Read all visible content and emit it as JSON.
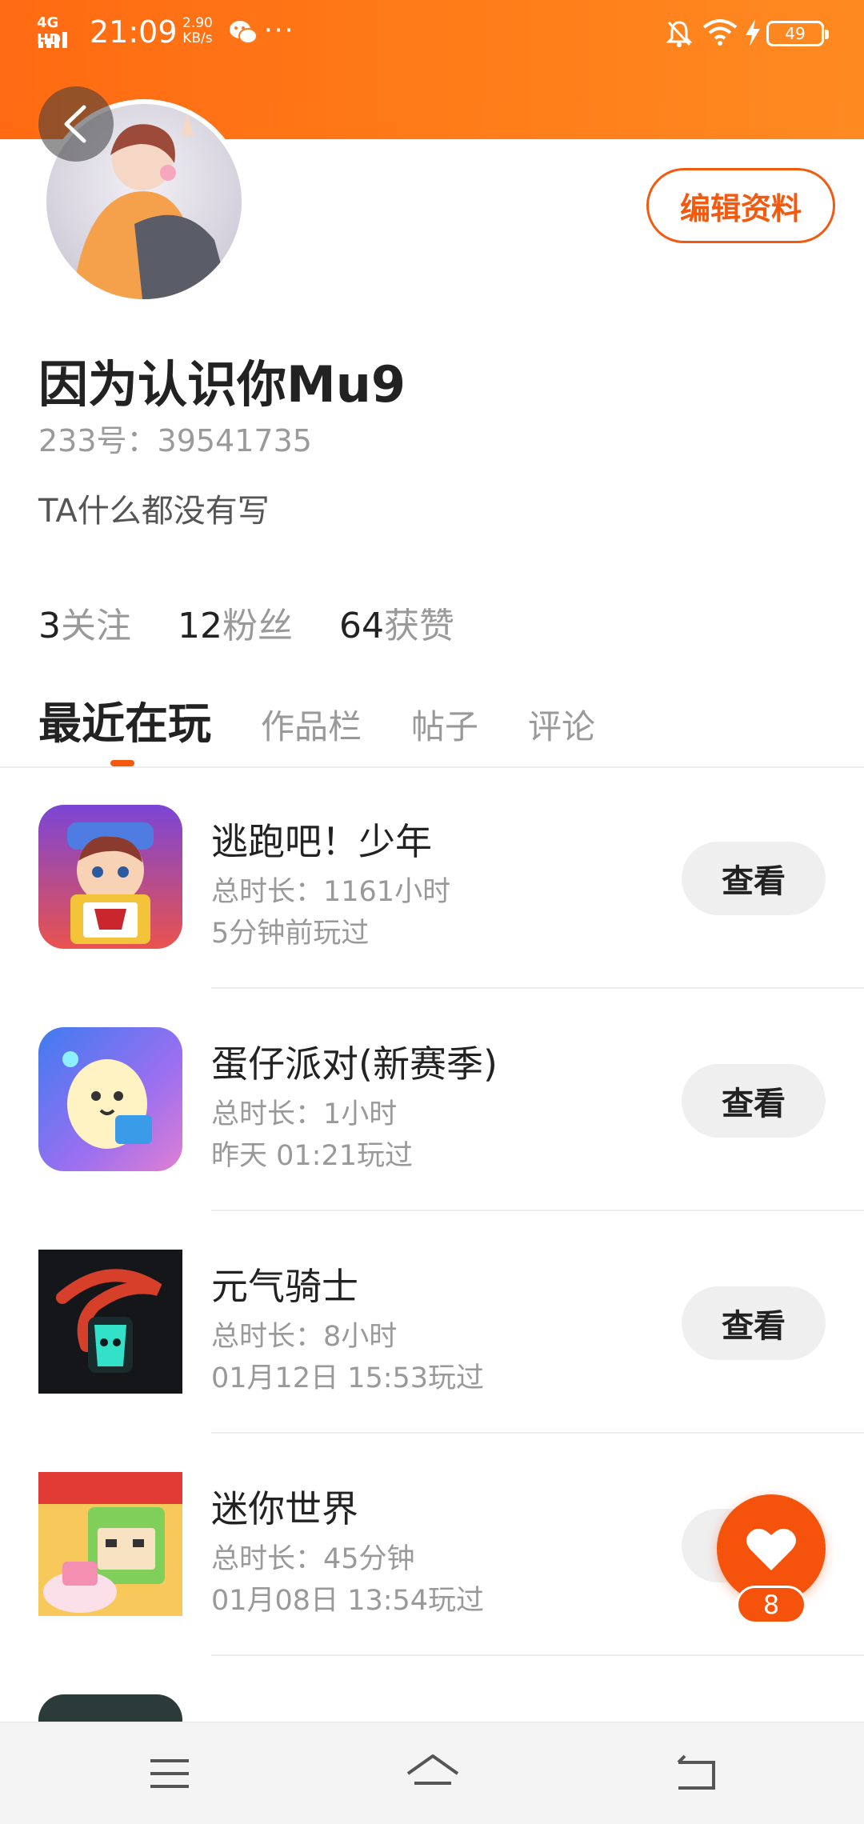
{
  "status_bar": {
    "network": "4G HD",
    "time": "21:09",
    "speed_value": "2.90",
    "speed_unit": "KB/s",
    "more": "···",
    "battery": "49",
    "icons": [
      "signal-icon",
      "wechat-icon",
      "mute-icon",
      "wifi-icon",
      "charging-icon",
      "battery-icon"
    ]
  },
  "profile": {
    "username": "因为认识你Mu9",
    "id_text": "233号：39541735",
    "bio": "TA什么都没有写",
    "edit_label": "编辑资料"
  },
  "stats": [
    {
      "num": "3",
      "label": "关注"
    },
    {
      "num": "12",
      "label": "粉丝"
    },
    {
      "num": "64",
      "label": "获赞"
    }
  ],
  "tabs": [
    "最近在玩",
    "作品栏",
    "帖子",
    "评论"
  ],
  "games": [
    {
      "name": "逃跑吧！少年",
      "duration": "总时长：1161小时",
      "last_played": "5分钟前玩过",
      "action": "查看"
    },
    {
      "name": "蛋仔派对(新赛季)",
      "duration": "总时长：1小时",
      "last_played": "昨天 01:21玩过",
      "action": "查看"
    },
    {
      "name": "元气骑士",
      "duration": "总时长：8小时",
      "last_played": "01月12日 15:53玩过",
      "action": "查看"
    },
    {
      "name": "迷你世界",
      "duration": "总时长：45分钟",
      "last_played": "01月08日 13:54玩过",
      "action": "查看"
    }
  ],
  "like": {
    "count": "8"
  },
  "colors": {
    "accent": "#f25a0f",
    "header": "#ff7a1a"
  }
}
